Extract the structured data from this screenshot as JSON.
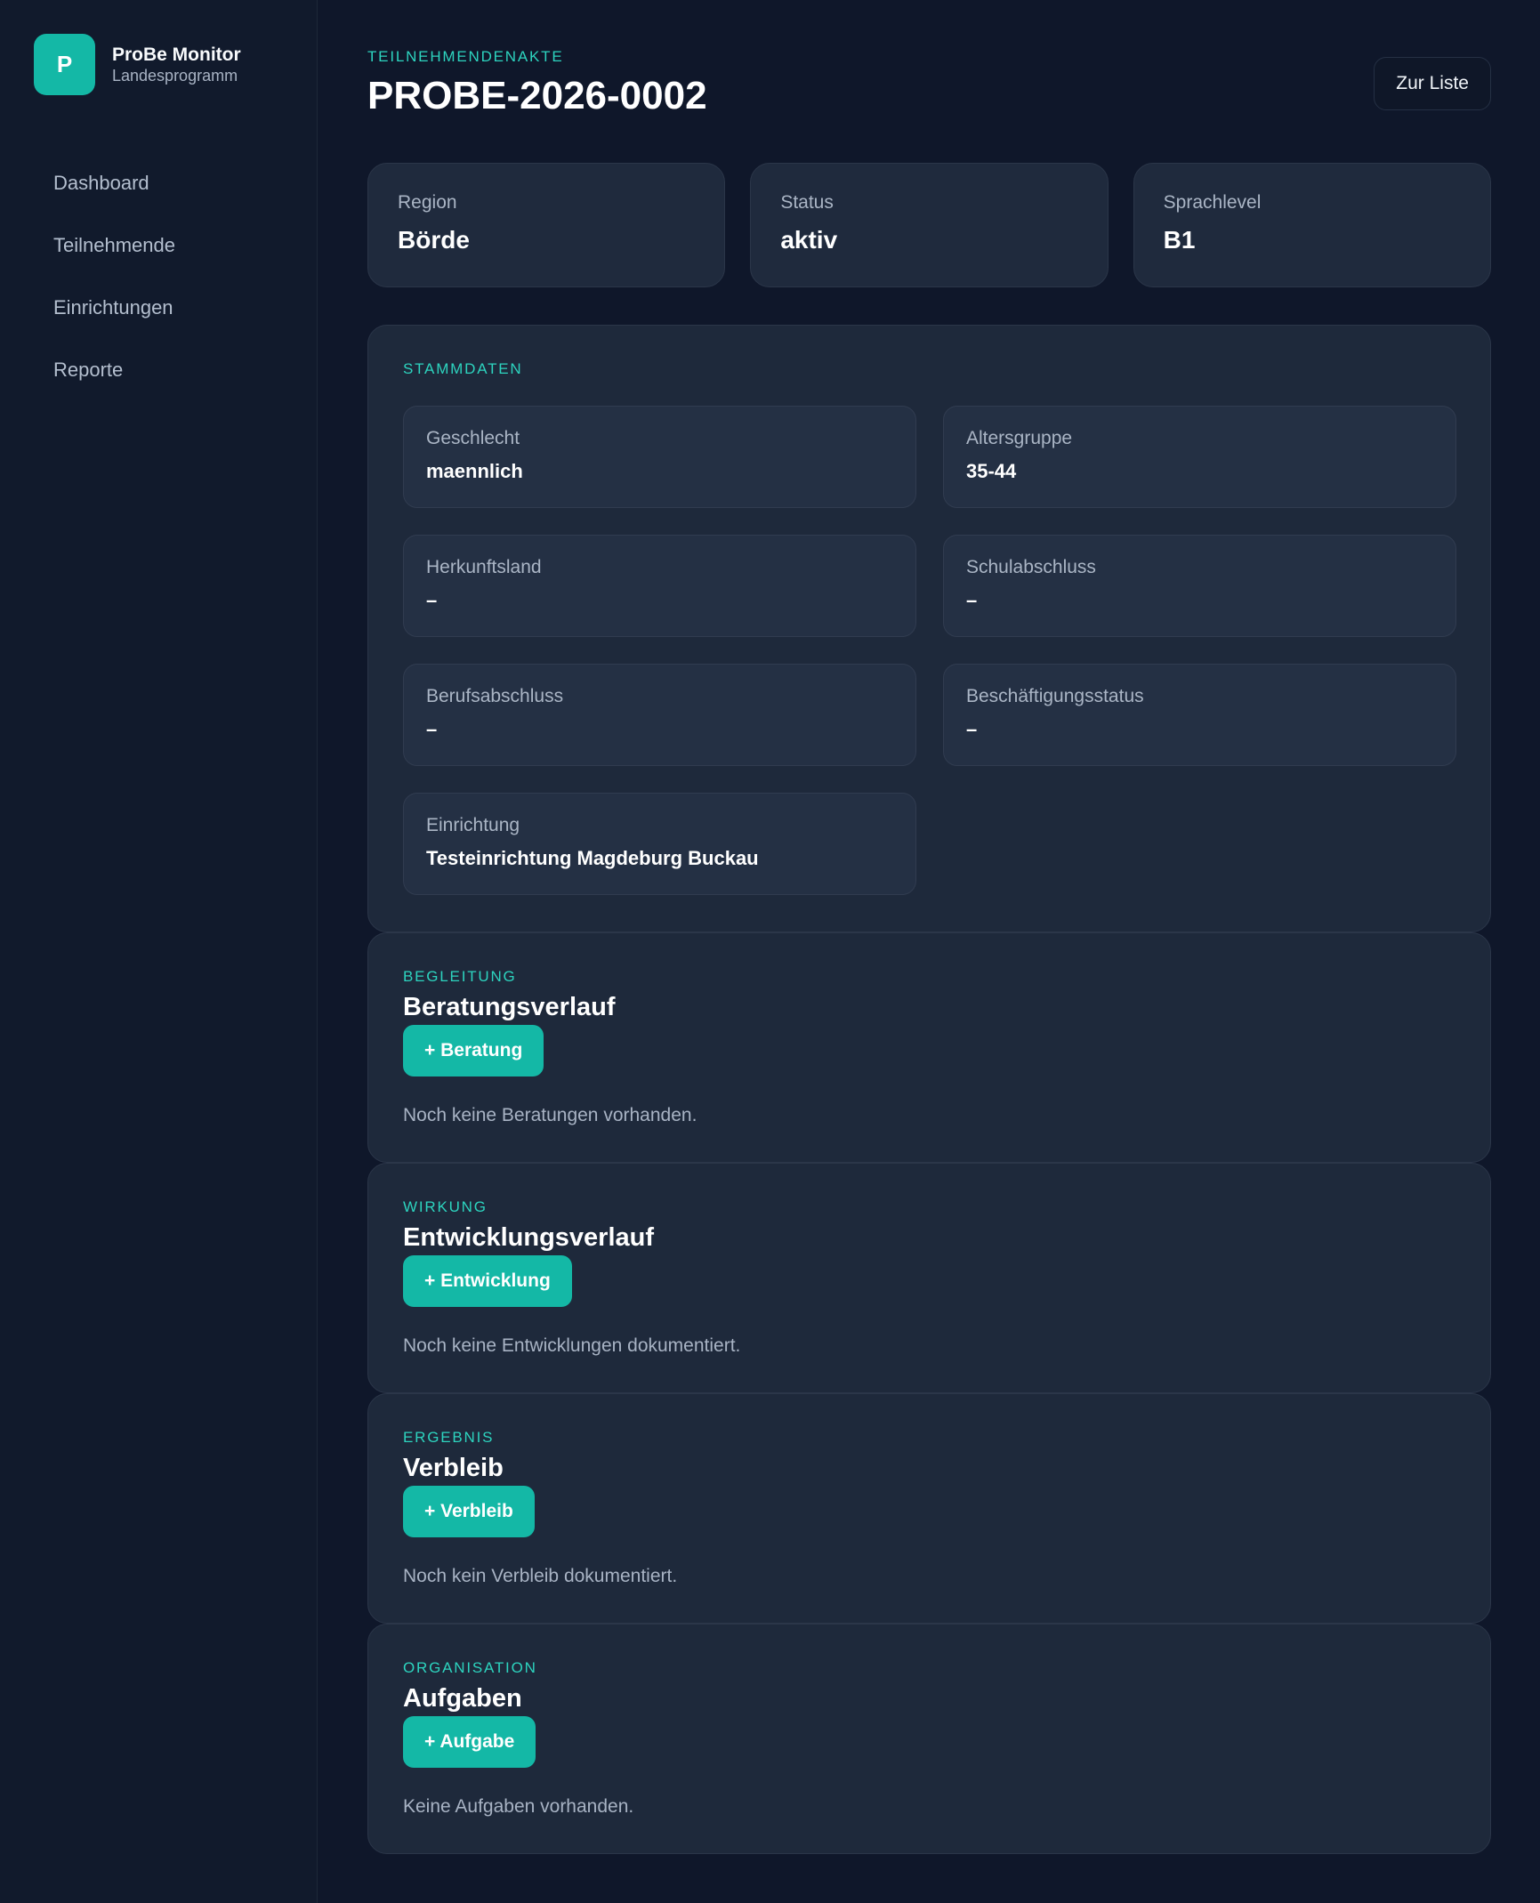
{
  "app": {
    "logo_letter": "P",
    "name": "ProBe Monitor",
    "subtitle": "Landesprogramm"
  },
  "nav": [
    "Dashboard",
    "Teilnehmende",
    "Einrichtungen",
    "Reporte"
  ],
  "header": {
    "eyebrow": "TEILNEHMENDENAKTE",
    "title": "PROBE-2026-0002",
    "back_label": "Zur Liste"
  },
  "stats": [
    {
      "label": "Region",
      "value": "Börde"
    },
    {
      "label": "Status",
      "value": "aktiv"
    },
    {
      "label": "Sprachlevel",
      "value": "B1"
    }
  ],
  "stammdaten": {
    "eyebrow": "STAMMDATEN",
    "fields": [
      {
        "label": "Geschlecht",
        "value": "maennlich"
      },
      {
        "label": "Altersgruppe",
        "value": "35-44"
      },
      {
        "label": "Herkunftsland",
        "value": "–"
      },
      {
        "label": "Schulabschluss",
        "value": "–"
      },
      {
        "label": "Berufsabschluss",
        "value": "–"
      },
      {
        "label": "Beschäftigungsstatus",
        "value": "–"
      },
      {
        "label": "Einrichtung",
        "value": "Testeinrichtung Magdeburg Buckau"
      }
    ]
  },
  "sections": [
    {
      "eyebrow": "BEGLEITUNG",
      "title": "Beratungsverlauf",
      "button": "+ Beratung",
      "empty": "Noch keine Beratungen vorhanden."
    },
    {
      "eyebrow": "WIRKUNG",
      "title": "Entwicklungsverlauf",
      "button": "+ Entwicklung",
      "empty": "Noch keine Entwicklungen dokumentiert."
    },
    {
      "eyebrow": "ERGEBNIS",
      "title": "Verbleib",
      "button": "+ Verbleib",
      "empty": "Noch kein Verbleib dokumentiert."
    },
    {
      "eyebrow": "ORGANISATION",
      "title": "Aufgaben",
      "button": "+ Aufgabe",
      "empty": "Keine Aufgaben vorhanden."
    }
  ],
  "colors": {
    "accent": "#14b8a6",
    "background": "#0f172a",
    "panel": "#1e293b"
  }
}
